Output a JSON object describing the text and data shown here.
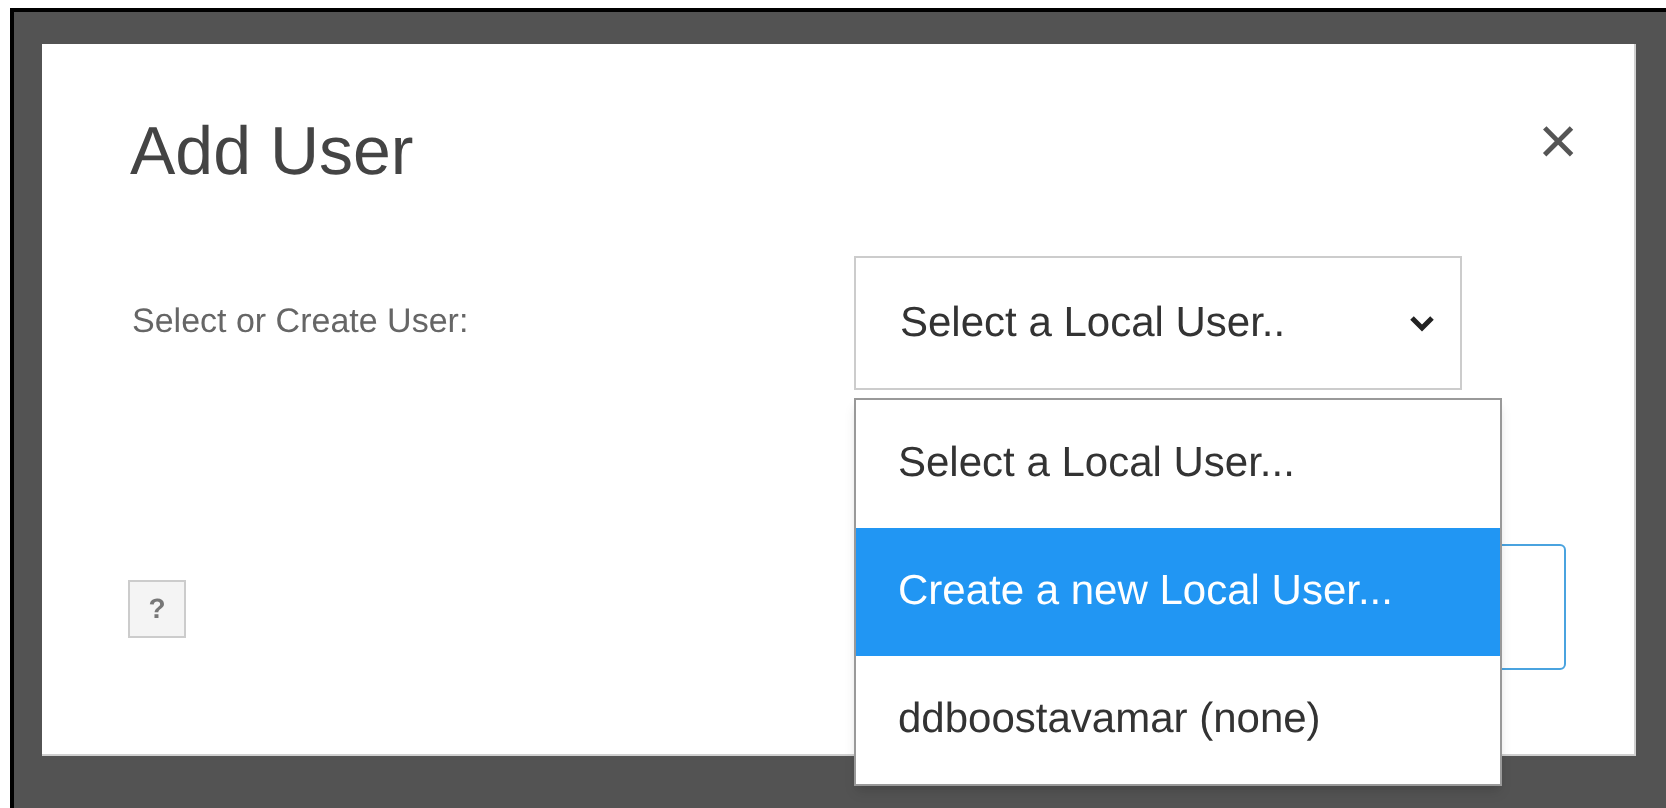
{
  "dialog": {
    "title": "Add User",
    "close": "×",
    "help": "?",
    "field": {
      "label": "Select or Create User:",
      "value": "Select a Local User.."
    },
    "dropdown": {
      "options": [
        {
          "label": "Select a Local User...",
          "selected": false
        },
        {
          "label": "Create a new Local User...",
          "selected": true
        },
        {
          "label": "ddboostavamar (none)",
          "selected": false
        }
      ]
    }
  }
}
